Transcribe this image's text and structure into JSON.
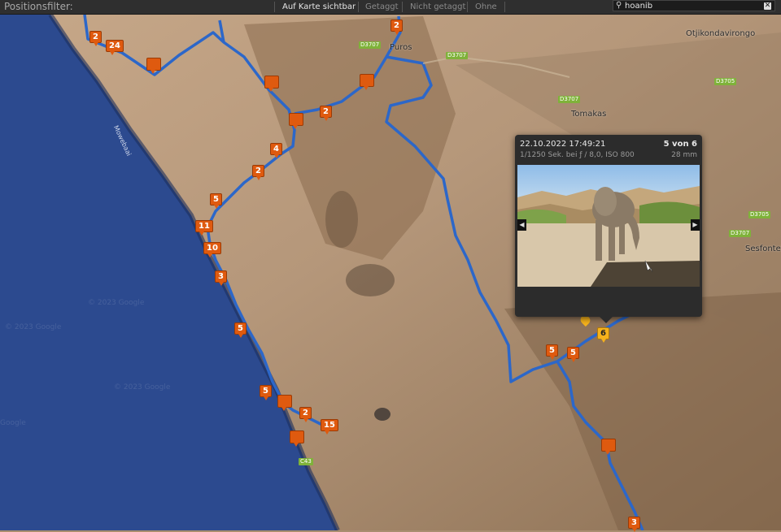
{
  "filter_bar": {
    "title": "Positionsfilter:",
    "options": [
      "Auf Karte sichtbar",
      "Getaggt",
      "Nicht getaggt",
      "Ohne"
    ],
    "active_option": "Auf Karte sichtbar",
    "search_value": "hoanib",
    "search_icon": "search-icon",
    "clear_icon": "close-icon"
  },
  "map": {
    "places": [
      "Otjikondavirongo",
      "Tomakas",
      "Sesfontein",
      "Puros",
      "Mowebaai"
    ],
    "road_labels": [
      "D3707",
      "D3707",
      "D3707",
      "D3707",
      "D3705",
      "D3705",
      "D3707",
      "C43"
    ],
    "watermarks": [
      "© 2023 Google",
      "© 2023 Google",
      "© 2023 Google",
      "Google"
    ],
    "markers": [
      "2",
      "2",
      "24",
      "",
      "",
      "",
      "2",
      "",
      "4",
      "2",
      "5",
      "11",
      "10",
      "3",
      "5",
      "5",
      "",
      "2",
      "15",
      "",
      "5",
      "5",
      "6",
      "",
      "3"
    ],
    "selected_marker": "6",
    "colors": {
      "ocean": "#2c4a8f",
      "route": "#2c67c9",
      "marker": "#df5a0f",
      "marker_selected": "#f5b21c"
    }
  },
  "popup": {
    "datetime": "22.10.2022 17:49:21",
    "counter": "5 von 6",
    "exif": "1/1250 Sek. bei ƒ / 8,0, ISO 800",
    "focal_length": "28 mm",
    "prev_icon": "chevron-left-icon",
    "next_icon": "chevron-right-icon"
  }
}
